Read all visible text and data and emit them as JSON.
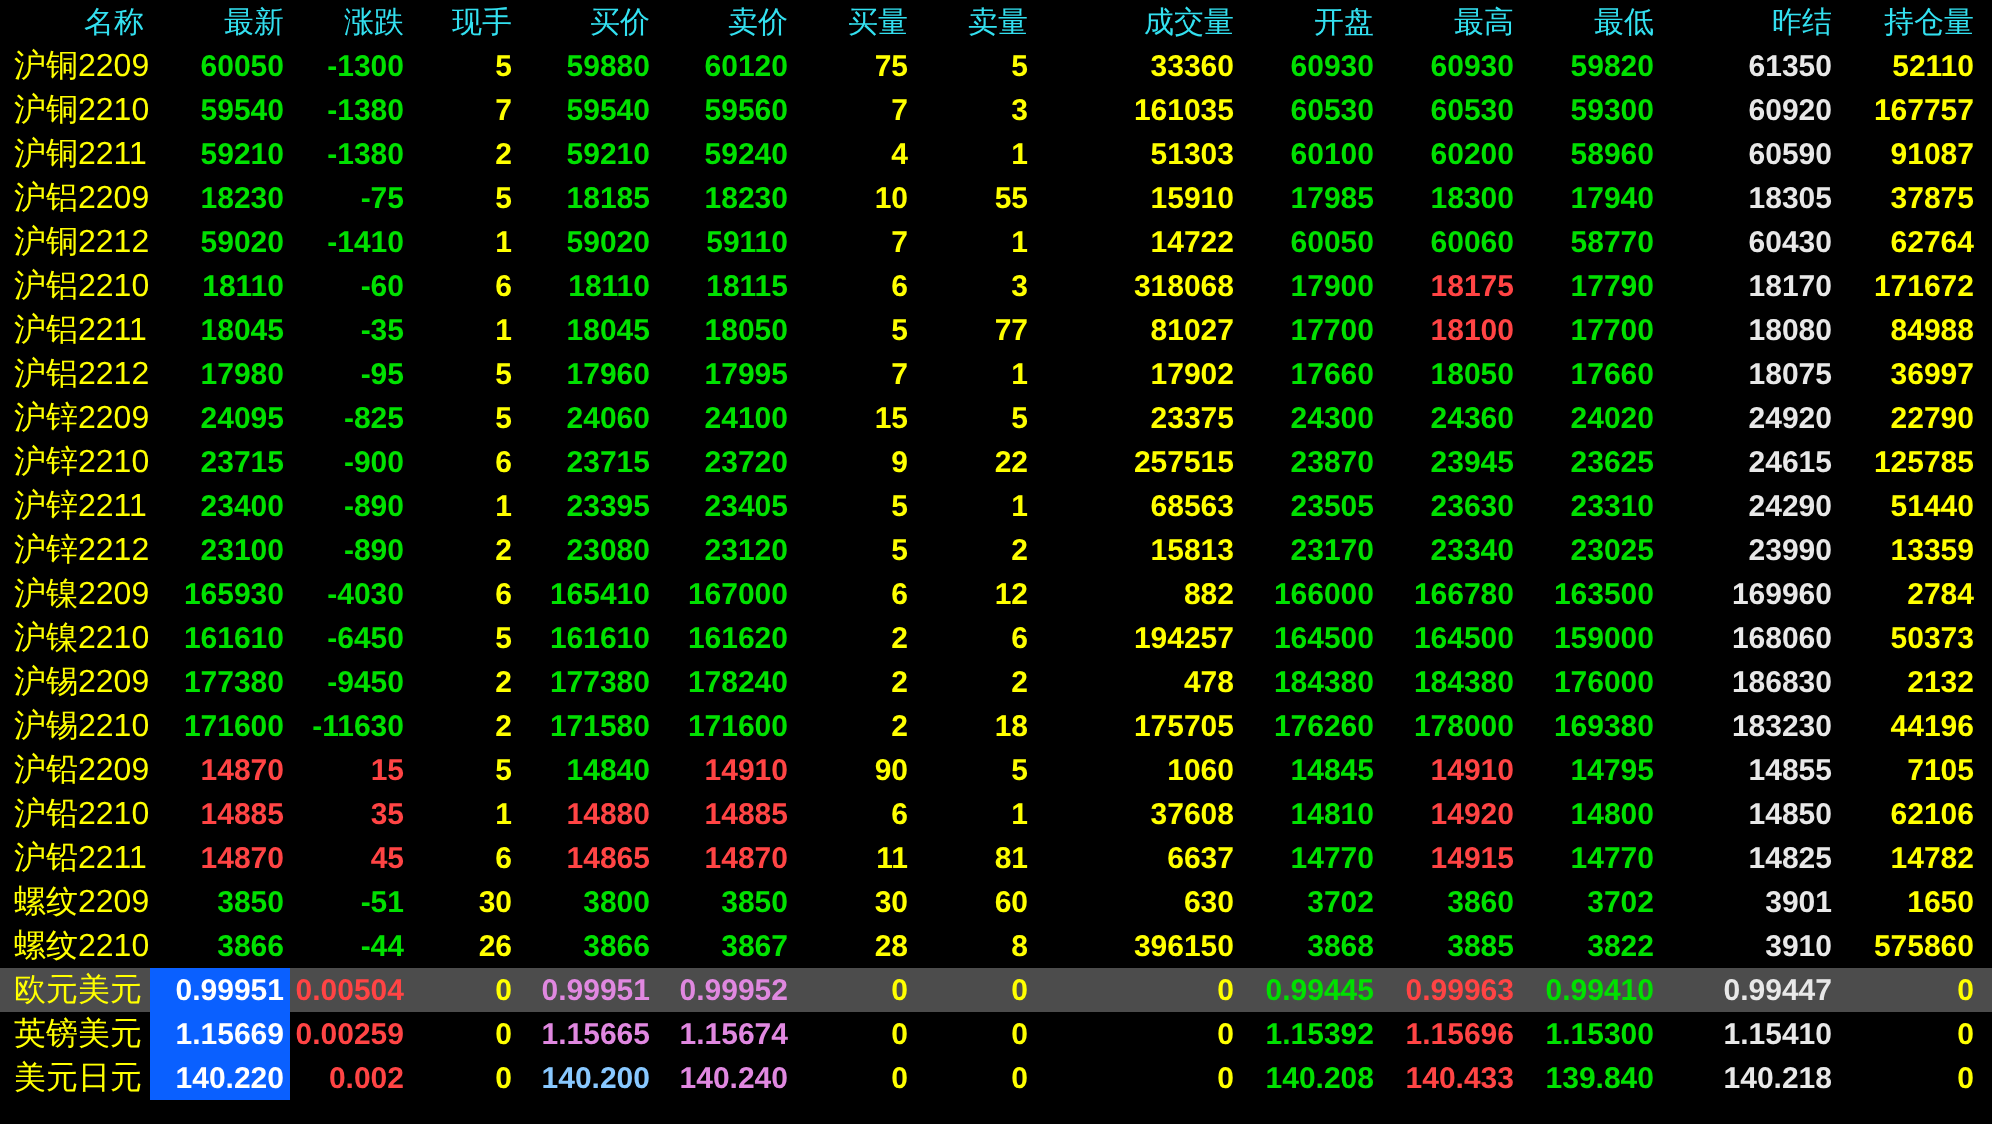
{
  "columns": [
    "名称",
    "最新",
    "涨跌",
    "现手",
    "买价",
    "卖价",
    "买量",
    "卖量",
    "成交量",
    "开盘",
    "最高",
    "最低",
    "昨结",
    "持仓量"
  ],
  "rows": [
    {
      "name": "沪铜2209",
      "selected": false,
      "last_marked": false,
      "cells": [
        {
          "text": "60050",
          "color": "#00e000"
        },
        {
          "text": "-1300",
          "color": "#00e000"
        },
        {
          "text": "5",
          "color": "#ffff00"
        },
        {
          "text": "59880",
          "color": "#00e000"
        },
        {
          "text": "60120",
          "color": "#00e000"
        },
        {
          "text": "75",
          "color": "#ffff00"
        },
        {
          "text": "5",
          "color": "#ffff00"
        },
        {
          "text": "33360",
          "color": "#ffff00"
        },
        {
          "text": "60930",
          "color": "#00e000"
        },
        {
          "text": "60930",
          "color": "#00e000"
        },
        {
          "text": "59820",
          "color": "#00e000"
        },
        {
          "text": "61350",
          "color": "#e8e8e8"
        },
        {
          "text": "52110",
          "color": "#ffff00"
        }
      ]
    },
    {
      "name": "沪铜2210",
      "selected": false,
      "last_marked": false,
      "cells": [
        {
          "text": "59540",
          "color": "#00e000"
        },
        {
          "text": "-1380",
          "color": "#00e000"
        },
        {
          "text": "7",
          "color": "#ffff00"
        },
        {
          "text": "59540",
          "color": "#00e000"
        },
        {
          "text": "59560",
          "color": "#00e000"
        },
        {
          "text": "7",
          "color": "#ffff00"
        },
        {
          "text": "3",
          "color": "#ffff00"
        },
        {
          "text": "161035",
          "color": "#ffff00"
        },
        {
          "text": "60530",
          "color": "#00e000"
        },
        {
          "text": "60530",
          "color": "#00e000"
        },
        {
          "text": "59300",
          "color": "#00e000"
        },
        {
          "text": "60920",
          "color": "#e8e8e8"
        },
        {
          "text": "167757",
          "color": "#ffff00"
        }
      ]
    },
    {
      "name": "沪铜2211",
      "selected": false,
      "last_marked": false,
      "cells": [
        {
          "text": "59210",
          "color": "#00e000"
        },
        {
          "text": "-1380",
          "color": "#00e000"
        },
        {
          "text": "2",
          "color": "#ffff00"
        },
        {
          "text": "59210",
          "color": "#00e000"
        },
        {
          "text": "59240",
          "color": "#00e000"
        },
        {
          "text": "4",
          "color": "#ffff00"
        },
        {
          "text": "1",
          "color": "#ffff00"
        },
        {
          "text": "51303",
          "color": "#ffff00"
        },
        {
          "text": "60100",
          "color": "#00e000"
        },
        {
          "text": "60200",
          "color": "#00e000"
        },
        {
          "text": "58960",
          "color": "#00e000"
        },
        {
          "text": "60590",
          "color": "#e8e8e8"
        },
        {
          "text": "91087",
          "color": "#ffff00"
        }
      ]
    },
    {
      "name": "沪铝2209",
      "selected": false,
      "last_marked": false,
      "cells": [
        {
          "text": "18230",
          "color": "#00e000"
        },
        {
          "text": "-75",
          "color": "#00e000"
        },
        {
          "text": "5",
          "color": "#ffff00"
        },
        {
          "text": "18185",
          "color": "#00e000"
        },
        {
          "text": "18230",
          "color": "#00e000"
        },
        {
          "text": "10",
          "color": "#ffff00"
        },
        {
          "text": "55",
          "color": "#ffff00"
        },
        {
          "text": "15910",
          "color": "#ffff00"
        },
        {
          "text": "17985",
          "color": "#00e000"
        },
        {
          "text": "18300",
          "color": "#00e000"
        },
        {
          "text": "17940",
          "color": "#00e000"
        },
        {
          "text": "18305",
          "color": "#e8e8e8"
        },
        {
          "text": "37875",
          "color": "#ffff00"
        }
      ]
    },
    {
      "name": "沪铜2212",
      "selected": false,
      "last_marked": false,
      "cells": [
        {
          "text": "59020",
          "color": "#00e000"
        },
        {
          "text": "-1410",
          "color": "#00e000"
        },
        {
          "text": "1",
          "color": "#ffff00"
        },
        {
          "text": "59020",
          "color": "#00e000"
        },
        {
          "text": "59110",
          "color": "#00e000"
        },
        {
          "text": "7",
          "color": "#ffff00"
        },
        {
          "text": "1",
          "color": "#ffff00"
        },
        {
          "text": "14722",
          "color": "#ffff00"
        },
        {
          "text": "60050",
          "color": "#00e000"
        },
        {
          "text": "60060",
          "color": "#00e000"
        },
        {
          "text": "58770",
          "color": "#00e000"
        },
        {
          "text": "60430",
          "color": "#e8e8e8"
        },
        {
          "text": "62764",
          "color": "#ffff00"
        }
      ]
    },
    {
      "name": "沪铝2210",
      "selected": false,
      "last_marked": false,
      "cells": [
        {
          "text": "18110",
          "color": "#00e000"
        },
        {
          "text": "-60",
          "color": "#00e000"
        },
        {
          "text": "6",
          "color": "#ffff00"
        },
        {
          "text": "18110",
          "color": "#00e000"
        },
        {
          "text": "18115",
          "color": "#00e000"
        },
        {
          "text": "6",
          "color": "#ffff00"
        },
        {
          "text": "3",
          "color": "#ffff00"
        },
        {
          "text": "318068",
          "color": "#ffff00"
        },
        {
          "text": "17900",
          "color": "#00e000"
        },
        {
          "text": "18175",
          "color": "#ff4444"
        },
        {
          "text": "17790",
          "color": "#00e000"
        },
        {
          "text": "18170",
          "color": "#e8e8e8"
        },
        {
          "text": "171672",
          "color": "#ffff00"
        }
      ]
    },
    {
      "name": "沪铝2211",
      "selected": false,
      "last_marked": false,
      "cells": [
        {
          "text": "18045",
          "color": "#00e000"
        },
        {
          "text": "-35",
          "color": "#00e000"
        },
        {
          "text": "1",
          "color": "#ffff00"
        },
        {
          "text": "18045",
          "color": "#00e000"
        },
        {
          "text": "18050",
          "color": "#00e000"
        },
        {
          "text": "5",
          "color": "#ffff00"
        },
        {
          "text": "77",
          "color": "#ffff00"
        },
        {
          "text": "81027",
          "color": "#ffff00"
        },
        {
          "text": "17700",
          "color": "#00e000"
        },
        {
          "text": "18100",
          "color": "#ff4444"
        },
        {
          "text": "17700",
          "color": "#00e000"
        },
        {
          "text": "18080",
          "color": "#e8e8e8"
        },
        {
          "text": "84988",
          "color": "#ffff00"
        }
      ]
    },
    {
      "name": "沪铝2212",
      "selected": false,
      "last_marked": false,
      "cells": [
        {
          "text": "17980",
          "color": "#00e000"
        },
        {
          "text": "-95",
          "color": "#00e000"
        },
        {
          "text": "5",
          "color": "#ffff00"
        },
        {
          "text": "17960",
          "color": "#00e000"
        },
        {
          "text": "17995",
          "color": "#00e000"
        },
        {
          "text": "7",
          "color": "#ffff00"
        },
        {
          "text": "1",
          "color": "#ffff00"
        },
        {
          "text": "17902",
          "color": "#ffff00"
        },
        {
          "text": "17660",
          "color": "#00e000"
        },
        {
          "text": "18050",
          "color": "#00e000"
        },
        {
          "text": "17660",
          "color": "#00e000"
        },
        {
          "text": "18075",
          "color": "#e8e8e8"
        },
        {
          "text": "36997",
          "color": "#ffff00"
        }
      ]
    },
    {
      "name": "沪锌2209",
      "selected": false,
      "last_marked": false,
      "cells": [
        {
          "text": "24095",
          "color": "#00e000"
        },
        {
          "text": "-825",
          "color": "#00e000"
        },
        {
          "text": "5",
          "color": "#ffff00"
        },
        {
          "text": "24060",
          "color": "#00e000"
        },
        {
          "text": "24100",
          "color": "#00e000"
        },
        {
          "text": "15",
          "color": "#ffff00"
        },
        {
          "text": "5",
          "color": "#ffff00"
        },
        {
          "text": "23375",
          "color": "#ffff00"
        },
        {
          "text": "24300",
          "color": "#00e000"
        },
        {
          "text": "24360",
          "color": "#00e000"
        },
        {
          "text": "24020",
          "color": "#00e000"
        },
        {
          "text": "24920",
          "color": "#e8e8e8"
        },
        {
          "text": "22790",
          "color": "#ffff00"
        }
      ]
    },
    {
      "name": "沪锌2210",
      "selected": false,
      "last_marked": false,
      "cells": [
        {
          "text": "23715",
          "color": "#00e000"
        },
        {
          "text": "-900",
          "color": "#00e000"
        },
        {
          "text": "6",
          "color": "#ffff00"
        },
        {
          "text": "23715",
          "color": "#00e000"
        },
        {
          "text": "23720",
          "color": "#00e000"
        },
        {
          "text": "9",
          "color": "#ffff00"
        },
        {
          "text": "22",
          "color": "#ffff00"
        },
        {
          "text": "257515",
          "color": "#ffff00"
        },
        {
          "text": "23870",
          "color": "#00e000"
        },
        {
          "text": "23945",
          "color": "#00e000"
        },
        {
          "text": "23625",
          "color": "#00e000"
        },
        {
          "text": "24615",
          "color": "#e8e8e8"
        },
        {
          "text": "125785",
          "color": "#ffff00"
        }
      ]
    },
    {
      "name": "沪锌2211",
      "selected": false,
      "last_marked": false,
      "cells": [
        {
          "text": "23400",
          "color": "#00e000"
        },
        {
          "text": "-890",
          "color": "#00e000"
        },
        {
          "text": "1",
          "color": "#ffff00"
        },
        {
          "text": "23395",
          "color": "#00e000"
        },
        {
          "text": "23405",
          "color": "#00e000"
        },
        {
          "text": "5",
          "color": "#ffff00"
        },
        {
          "text": "1",
          "color": "#ffff00"
        },
        {
          "text": "68563",
          "color": "#ffff00"
        },
        {
          "text": "23505",
          "color": "#00e000"
        },
        {
          "text": "23630",
          "color": "#00e000"
        },
        {
          "text": "23310",
          "color": "#00e000"
        },
        {
          "text": "24290",
          "color": "#e8e8e8"
        },
        {
          "text": "51440",
          "color": "#ffff00"
        }
      ]
    },
    {
      "name": "沪锌2212",
      "selected": false,
      "last_marked": false,
      "cells": [
        {
          "text": "23100",
          "color": "#00e000"
        },
        {
          "text": "-890",
          "color": "#00e000"
        },
        {
          "text": "2",
          "color": "#ffff00"
        },
        {
          "text": "23080",
          "color": "#00e000"
        },
        {
          "text": "23120",
          "color": "#00e000"
        },
        {
          "text": "5",
          "color": "#ffff00"
        },
        {
          "text": "2",
          "color": "#ffff00"
        },
        {
          "text": "15813",
          "color": "#ffff00"
        },
        {
          "text": "23170",
          "color": "#00e000"
        },
        {
          "text": "23340",
          "color": "#00e000"
        },
        {
          "text": "23025",
          "color": "#00e000"
        },
        {
          "text": "23990",
          "color": "#e8e8e8"
        },
        {
          "text": "13359",
          "color": "#ffff00"
        }
      ]
    },
    {
      "name": "沪镍2209",
      "selected": false,
      "last_marked": false,
      "cells": [
        {
          "text": "165930",
          "color": "#00e000"
        },
        {
          "text": "-4030",
          "color": "#00e000"
        },
        {
          "text": "6",
          "color": "#ffff00"
        },
        {
          "text": "165410",
          "color": "#00e000"
        },
        {
          "text": "167000",
          "color": "#00e000"
        },
        {
          "text": "6",
          "color": "#ffff00"
        },
        {
          "text": "12",
          "color": "#ffff00"
        },
        {
          "text": "882",
          "color": "#ffff00"
        },
        {
          "text": "166000",
          "color": "#00e000"
        },
        {
          "text": "166780",
          "color": "#00e000"
        },
        {
          "text": "163500",
          "color": "#00e000"
        },
        {
          "text": "169960",
          "color": "#e8e8e8"
        },
        {
          "text": "2784",
          "color": "#ffff00"
        }
      ]
    },
    {
      "name": "沪镍2210",
      "selected": false,
      "last_marked": false,
      "cells": [
        {
          "text": "161610",
          "color": "#00e000"
        },
        {
          "text": "-6450",
          "color": "#00e000"
        },
        {
          "text": "5",
          "color": "#ffff00"
        },
        {
          "text": "161610",
          "color": "#00e000"
        },
        {
          "text": "161620",
          "color": "#00e000"
        },
        {
          "text": "2",
          "color": "#ffff00"
        },
        {
          "text": "6",
          "color": "#ffff00"
        },
        {
          "text": "194257",
          "color": "#ffff00"
        },
        {
          "text": "164500",
          "color": "#00e000"
        },
        {
          "text": "164500",
          "color": "#00e000"
        },
        {
          "text": "159000",
          "color": "#00e000"
        },
        {
          "text": "168060",
          "color": "#e8e8e8"
        },
        {
          "text": "50373",
          "color": "#ffff00"
        }
      ]
    },
    {
      "name": "沪锡2209",
      "selected": false,
      "last_marked": false,
      "cells": [
        {
          "text": "177380",
          "color": "#00e000"
        },
        {
          "text": "-9450",
          "color": "#00e000"
        },
        {
          "text": "2",
          "color": "#ffff00"
        },
        {
          "text": "177380",
          "color": "#00e000"
        },
        {
          "text": "178240",
          "color": "#00e000"
        },
        {
          "text": "2",
          "color": "#ffff00"
        },
        {
          "text": "2",
          "color": "#ffff00"
        },
        {
          "text": "478",
          "color": "#ffff00"
        },
        {
          "text": "184380",
          "color": "#00e000"
        },
        {
          "text": "184380",
          "color": "#00e000"
        },
        {
          "text": "176000",
          "color": "#00e000"
        },
        {
          "text": "186830",
          "color": "#e8e8e8"
        },
        {
          "text": "2132",
          "color": "#ffff00"
        }
      ]
    },
    {
      "name": "沪锡2210",
      "selected": false,
      "last_marked": false,
      "cells": [
        {
          "text": "171600",
          "color": "#00e000"
        },
        {
          "text": "-11630",
          "color": "#00e000"
        },
        {
          "text": "2",
          "color": "#ffff00"
        },
        {
          "text": "171580",
          "color": "#00e000"
        },
        {
          "text": "171600",
          "color": "#00e000"
        },
        {
          "text": "2",
          "color": "#ffff00"
        },
        {
          "text": "18",
          "color": "#ffff00"
        },
        {
          "text": "175705",
          "color": "#ffff00"
        },
        {
          "text": "176260",
          "color": "#00e000"
        },
        {
          "text": "178000",
          "color": "#00e000"
        },
        {
          "text": "169380",
          "color": "#00e000"
        },
        {
          "text": "183230",
          "color": "#e8e8e8"
        },
        {
          "text": "44196",
          "color": "#ffff00"
        }
      ]
    },
    {
      "name": "沪铅2209",
      "selected": false,
      "last_marked": false,
      "cells": [
        {
          "text": "14870",
          "color": "#ff4444"
        },
        {
          "text": "15",
          "color": "#ff4444"
        },
        {
          "text": "5",
          "color": "#ffff00"
        },
        {
          "text": "14840",
          "color": "#00e000"
        },
        {
          "text": "14910",
          "color": "#ff4444"
        },
        {
          "text": "90",
          "color": "#ffff00"
        },
        {
          "text": "5",
          "color": "#ffff00"
        },
        {
          "text": "1060",
          "color": "#ffff00"
        },
        {
          "text": "14845",
          "color": "#00e000"
        },
        {
          "text": "14910",
          "color": "#ff4444"
        },
        {
          "text": "14795",
          "color": "#00e000"
        },
        {
          "text": "14855",
          "color": "#e8e8e8"
        },
        {
          "text": "7105",
          "color": "#ffff00"
        }
      ]
    },
    {
      "name": "沪铅2210",
      "selected": false,
      "last_marked": false,
      "cells": [
        {
          "text": "14885",
          "color": "#ff4444"
        },
        {
          "text": "35",
          "color": "#ff4444"
        },
        {
          "text": "1",
          "color": "#ffff00"
        },
        {
          "text": "14880",
          "color": "#ff4444"
        },
        {
          "text": "14885",
          "color": "#ff4444"
        },
        {
          "text": "6",
          "color": "#ffff00"
        },
        {
          "text": "1",
          "color": "#ffff00"
        },
        {
          "text": "37608",
          "color": "#ffff00"
        },
        {
          "text": "14810",
          "color": "#00e000"
        },
        {
          "text": "14920",
          "color": "#ff4444"
        },
        {
          "text": "14800",
          "color": "#00e000"
        },
        {
          "text": "14850",
          "color": "#e8e8e8"
        },
        {
          "text": "62106",
          "color": "#ffff00"
        }
      ]
    },
    {
      "name": "沪铅2211",
      "selected": false,
      "last_marked": false,
      "cells": [
        {
          "text": "14870",
          "color": "#ff4444"
        },
        {
          "text": "45",
          "color": "#ff4444"
        },
        {
          "text": "6",
          "color": "#ffff00"
        },
        {
          "text": "14865",
          "color": "#ff4444"
        },
        {
          "text": "14870",
          "color": "#ff4444"
        },
        {
          "text": "11",
          "color": "#ffff00"
        },
        {
          "text": "81",
          "color": "#ffff00"
        },
        {
          "text": "6637",
          "color": "#ffff00"
        },
        {
          "text": "14770",
          "color": "#00e000"
        },
        {
          "text": "14915",
          "color": "#ff4444"
        },
        {
          "text": "14770",
          "color": "#00e000"
        },
        {
          "text": "14825",
          "color": "#e8e8e8"
        },
        {
          "text": "14782",
          "color": "#ffff00"
        }
      ]
    },
    {
      "name": "螺纹2209",
      "selected": false,
      "last_marked": false,
      "cells": [
        {
          "text": "3850",
          "color": "#00e000"
        },
        {
          "text": "-51",
          "color": "#00e000"
        },
        {
          "text": "30",
          "color": "#ffff00"
        },
        {
          "text": "3800",
          "color": "#00e000"
        },
        {
          "text": "3850",
          "color": "#00e000"
        },
        {
          "text": "30",
          "color": "#ffff00"
        },
        {
          "text": "60",
          "color": "#ffff00"
        },
        {
          "text": "630",
          "color": "#ffff00"
        },
        {
          "text": "3702",
          "color": "#00e000"
        },
        {
          "text": "3860",
          "color": "#00e000"
        },
        {
          "text": "3702",
          "color": "#00e000"
        },
        {
          "text": "3901",
          "color": "#e8e8e8"
        },
        {
          "text": "1650",
          "color": "#ffff00"
        }
      ]
    },
    {
      "name": "螺纹2210",
      "selected": false,
      "last_marked": false,
      "cells": [
        {
          "text": "3866",
          "color": "#00e000"
        },
        {
          "text": "-44",
          "color": "#00e000"
        },
        {
          "text": "26",
          "color": "#ffff00"
        },
        {
          "text": "3866",
          "color": "#00e000"
        },
        {
          "text": "3867",
          "color": "#00e000"
        },
        {
          "text": "28",
          "color": "#ffff00"
        },
        {
          "text": "8",
          "color": "#ffff00"
        },
        {
          "text": "396150",
          "color": "#ffff00"
        },
        {
          "text": "3868",
          "color": "#00e000"
        },
        {
          "text": "3885",
          "color": "#00e000"
        },
        {
          "text": "3822",
          "color": "#00e000"
        },
        {
          "text": "3910",
          "color": "#e8e8e8"
        },
        {
          "text": "575860",
          "color": "#ffff00"
        }
      ]
    },
    {
      "name": "欧元美元",
      "selected": true,
      "last_marked": true,
      "cells": [
        {
          "text": "0.99951",
          "color": "#ffffff"
        },
        {
          "text": "0.00504",
          "color": "#ff4444"
        },
        {
          "text": "0",
          "color": "#ffff00"
        },
        {
          "text": "0.99951",
          "color": "#e088e0"
        },
        {
          "text": "0.99952",
          "color": "#e088e0"
        },
        {
          "text": "0",
          "color": "#ffff00"
        },
        {
          "text": "0",
          "color": "#ffff00"
        },
        {
          "text": "0",
          "color": "#ffff00"
        },
        {
          "text": "0.99445",
          "color": "#00e000"
        },
        {
          "text": "0.99963",
          "color": "#ff4444"
        },
        {
          "text": "0.99410",
          "color": "#00e000"
        },
        {
          "text": "0.99447",
          "color": "#e8e8e8"
        },
        {
          "text": "0",
          "color": "#ffff00"
        }
      ]
    },
    {
      "name": "英镑美元",
      "selected": false,
      "last_marked": true,
      "cells": [
        {
          "text": "1.15669",
          "color": "#ffffff"
        },
        {
          "text": "0.00259",
          "color": "#ff4444"
        },
        {
          "text": "0",
          "color": "#ffff00"
        },
        {
          "text": "1.15665",
          "color": "#e088e0"
        },
        {
          "text": "1.15674",
          "color": "#e088e0"
        },
        {
          "text": "0",
          "color": "#ffff00"
        },
        {
          "text": "0",
          "color": "#ffff00"
        },
        {
          "text": "0",
          "color": "#ffff00"
        },
        {
          "text": "1.15392",
          "color": "#00e000"
        },
        {
          "text": "1.15696",
          "color": "#ff4444"
        },
        {
          "text": "1.15300",
          "color": "#00e000"
        },
        {
          "text": "1.15410",
          "color": "#e8e8e8"
        },
        {
          "text": "0",
          "color": "#ffff00"
        }
      ]
    },
    {
      "name": "美元日元",
      "selected": false,
      "last_marked": true,
      "cells": [
        {
          "text": "140.220",
          "color": "#ffffff"
        },
        {
          "text": "0.002",
          "color": "#ff4444"
        },
        {
          "text": "0",
          "color": "#ffff00"
        },
        {
          "text": "140.200",
          "color": "#88c8ff"
        },
        {
          "text": "140.240",
          "color": "#e088e0"
        },
        {
          "text": "0",
          "color": "#ffff00"
        },
        {
          "text": "0",
          "color": "#ffff00"
        },
        {
          "text": "0",
          "color": "#ffff00"
        },
        {
          "text": "140.208",
          "color": "#00e000"
        },
        {
          "text": "140.433",
          "color": "#ff4444"
        },
        {
          "text": "139.840",
          "color": "#00e000"
        },
        {
          "text": "140.218",
          "color": "#e8e8e8"
        },
        {
          "text": "0",
          "color": "#ffff00"
        }
      ]
    }
  ]
}
